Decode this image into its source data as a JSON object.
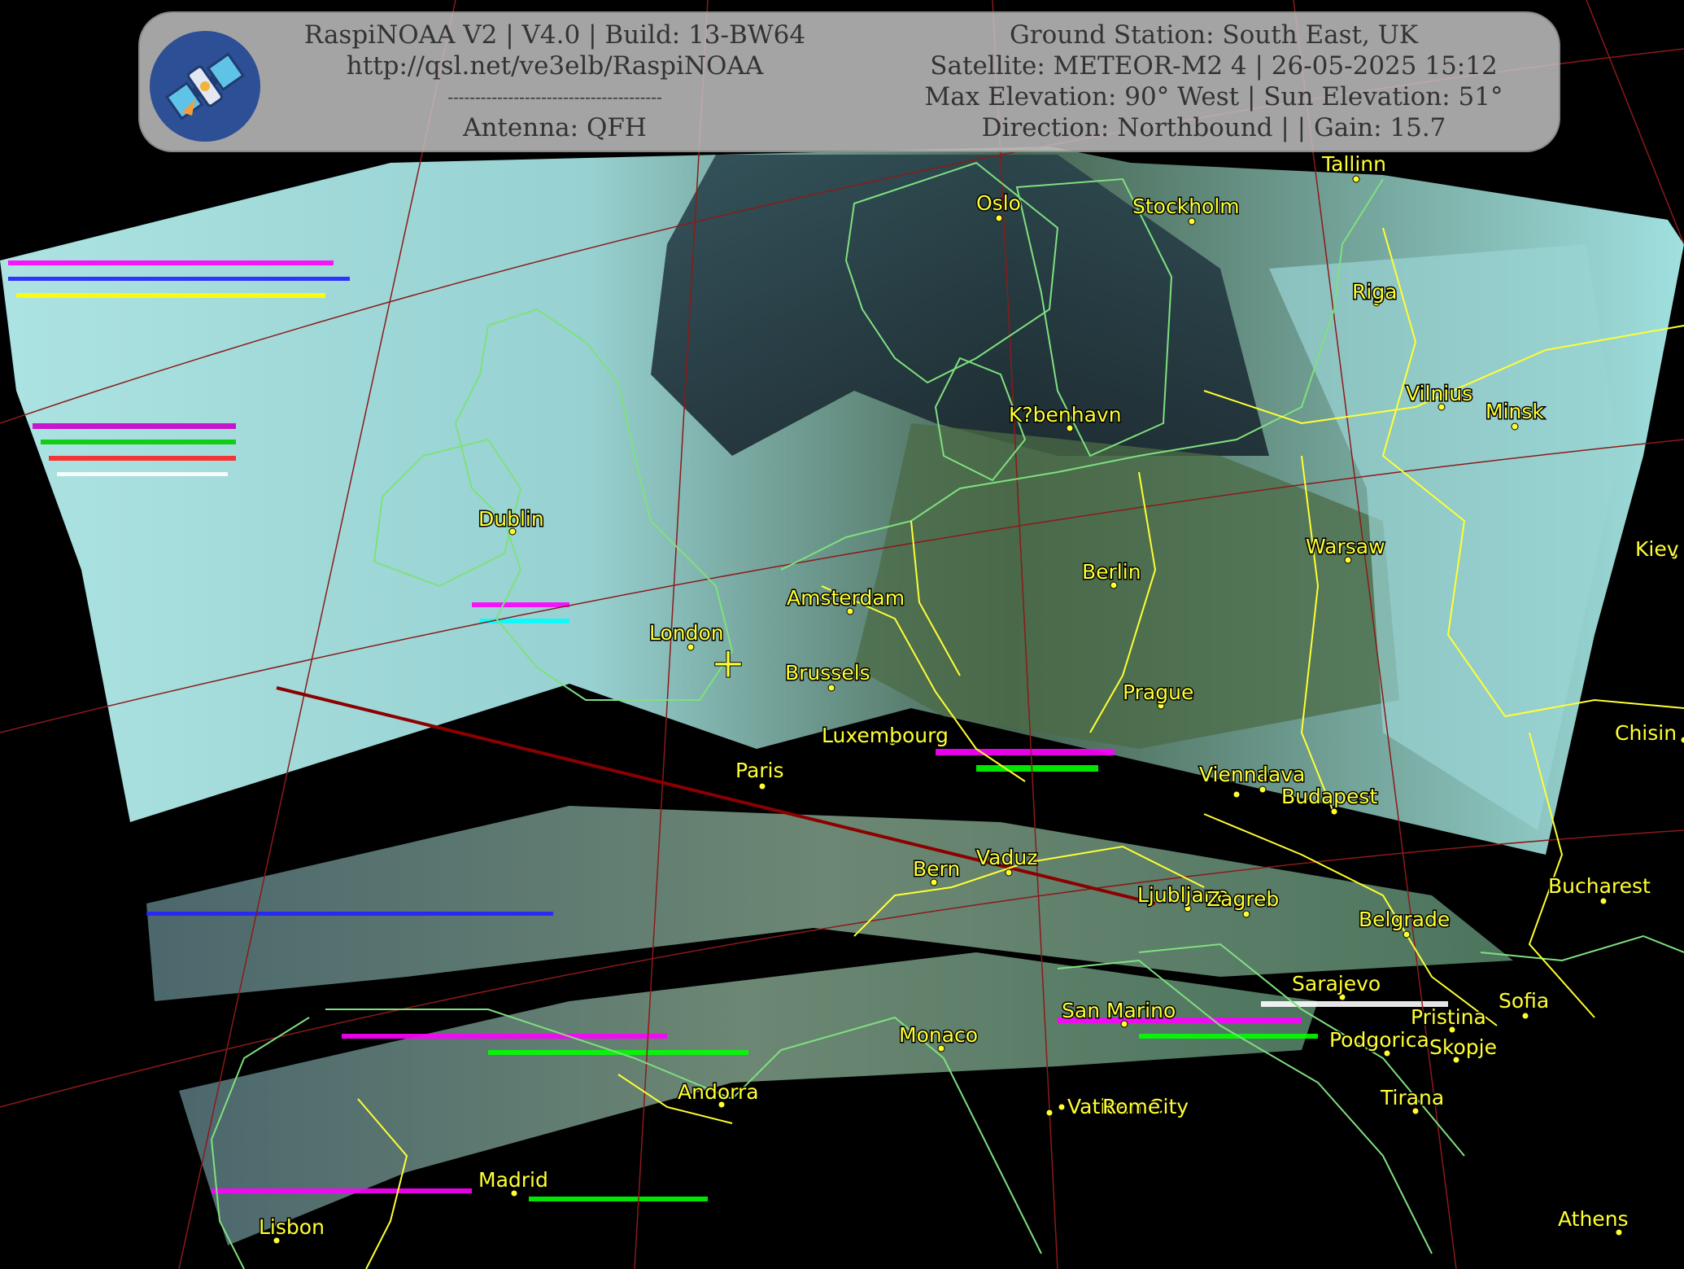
{
  "header": {
    "left_lines": [
      "RaspiNOAA V2 | V4.0 | Build: 13-BW64",
      "http://qsl.net/ve3elb/RaspiNOAA",
      "---------------------------------------",
      "Antenna: QFH"
    ],
    "right_lines": [
      "Ground Station: South East, UK",
      "Satellite: METEOR-M2 4 | 26-05-2025 15:12",
      "Max Elevation: 90° West | Sun Elevation: 51°",
      "Direction: Northbound | | Gain: 15.7"
    ]
  },
  "logo": {
    "icon": "satellite-icon",
    "background": "#2d4f95"
  },
  "colors": {
    "city": "#ffff33",
    "coastline": "#7fe07f",
    "border": "#ffff33",
    "graticule": "#8b1a1a",
    "track": "#8b0000",
    "cloud": "#a8ecec",
    "land": "#3d5e3a",
    "sea": "#1c2a35"
  },
  "cities": [
    {
      "name": "Oslo"
    },
    {
      "name": "Stockholm"
    },
    {
      "name": "Tallinn"
    },
    {
      "name": "Riga"
    },
    {
      "name": "Vilnius"
    },
    {
      "name": "Minsk"
    },
    {
      "name": "K?benhavn"
    },
    {
      "name": "Dublin"
    },
    {
      "name": "Amsterdam"
    },
    {
      "name": "London"
    },
    {
      "name": "Brussels"
    },
    {
      "name": "Berlin"
    },
    {
      "name": "Warsaw"
    },
    {
      "name": "Kiev"
    },
    {
      "name": "Prague"
    },
    {
      "name": "Luxembourg"
    },
    {
      "name": "Paris"
    },
    {
      "name": "Chisin"
    },
    {
      "name": "Vienna"
    },
    {
      "name": "lava"
    },
    {
      "name": "Budapest"
    },
    {
      "name": "Bern"
    },
    {
      "name": "Vaduz"
    },
    {
      "name": "Ljubljana"
    },
    {
      "name": "Zagreb"
    },
    {
      "name": "Belgrade"
    },
    {
      "name": "Bucharest"
    },
    {
      "name": "Sarajevo"
    },
    {
      "name": "Sofia"
    },
    {
      "name": "San Marino"
    },
    {
      "name": "Monaco"
    },
    {
      "name": "Pristina"
    },
    {
      "name": "Podgorica"
    },
    {
      "name": "Skopje"
    },
    {
      "name": "Andorra"
    },
    {
      "name": "Tirana"
    },
    {
      "name": "Vatican City"
    },
    {
      "name": "Rome"
    },
    {
      "name": "Madrid"
    },
    {
      "name": "Lisbon"
    },
    {
      "name": "Athens"
    }
  ],
  "ground_station_marker": {
    "label": "+"
  }
}
